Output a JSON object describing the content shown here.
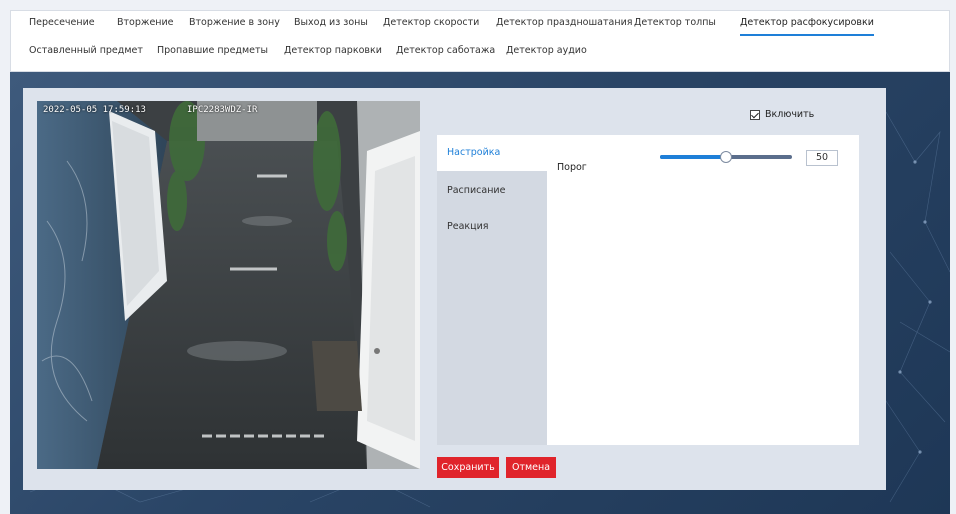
{
  "tabs_row1": [
    {
      "label": "Пересечение",
      "active": false
    },
    {
      "label": "Вторжение",
      "active": false
    },
    {
      "label": "Вторжение в зону",
      "active": false
    },
    {
      "label": "Выход из зоны",
      "active": false
    },
    {
      "label": "Детектор скорости",
      "active": false
    },
    {
      "label": "Детектор праздношатания",
      "active": false
    },
    {
      "label": "Детектор толпы",
      "active": false
    },
    {
      "label": "Детектор расфокусировки",
      "active": true
    }
  ],
  "tabs_row2": [
    {
      "label": "Оставленный предмет",
      "active": false
    },
    {
      "label": "Пропавшие предметы",
      "active": false
    },
    {
      "label": "Детектор парковки",
      "active": false
    },
    {
      "label": "Детектор саботажа",
      "active": false
    },
    {
      "label": "Детектор аудио",
      "active": false
    }
  ],
  "preview": {
    "timestamp": "2022-05-05 17:59:13",
    "camera_id": "IPC2283WDZ-IR"
  },
  "enable": {
    "label": "Включить",
    "checked": true
  },
  "sidebar": [
    {
      "label": "Настройка",
      "active": true
    },
    {
      "label": "Расписание",
      "active": false
    },
    {
      "label": "Реакция",
      "active": false
    }
  ],
  "threshold": {
    "label": "Порог",
    "value": "50",
    "fraction": 0.5
  },
  "buttons": {
    "save": "Сохранить",
    "cancel": "Отмена"
  },
  "colors": {
    "accent": "#1e7fd8",
    "danger": "#e0242b"
  }
}
